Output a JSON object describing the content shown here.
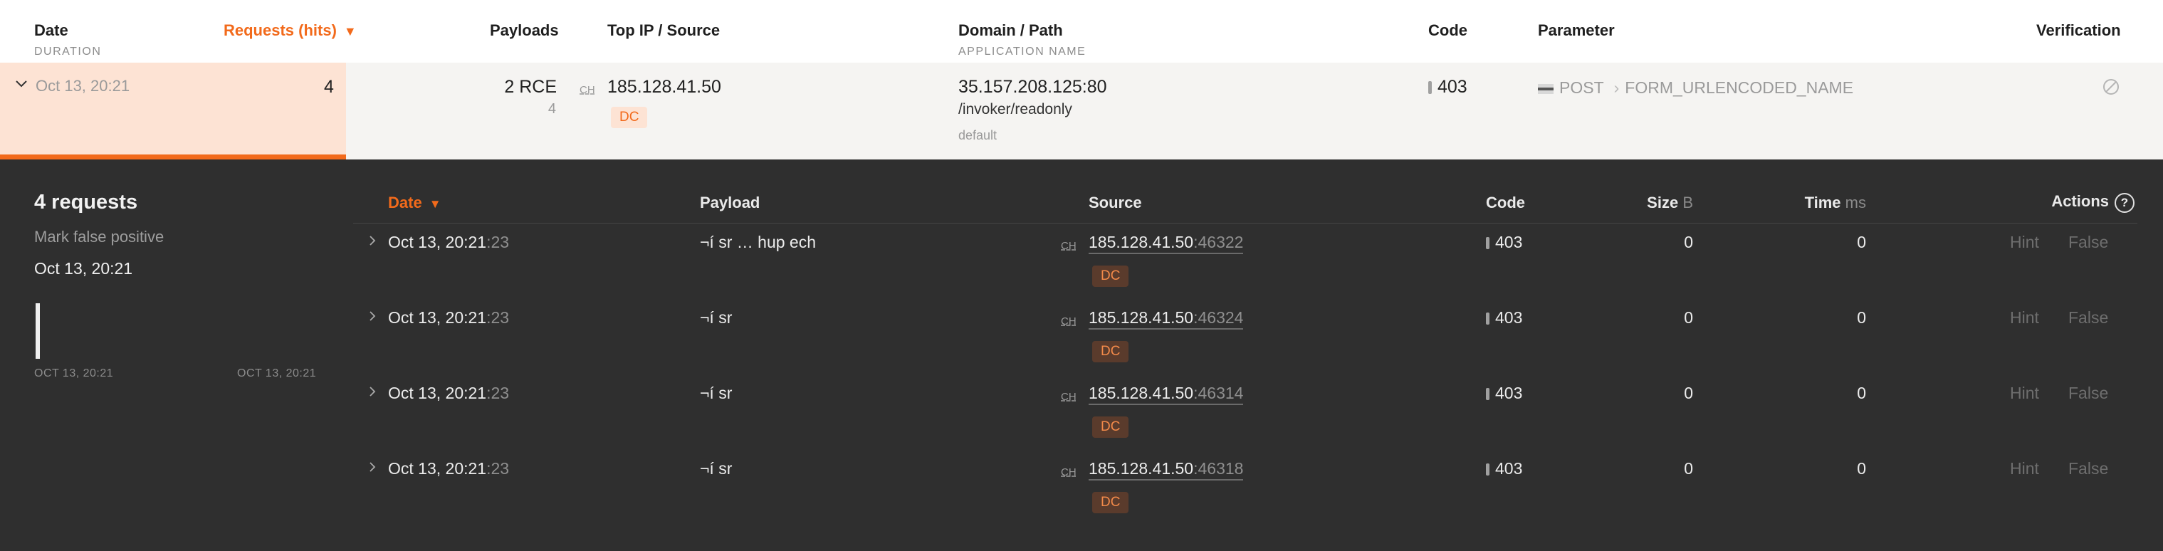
{
  "header": {
    "date": "Date",
    "duration": "DURATION",
    "requests": "Requests (hits)",
    "requests_caret": "▼",
    "payloads": "Payloads",
    "top_ip": "Top IP / Source",
    "domain": "Domain / Path",
    "app_name": "APPLICATION NAME",
    "code": "Code",
    "parameter": "Parameter",
    "verification": "Verification"
  },
  "summary": {
    "date": "Oct 13, 20:21",
    "hits": "4",
    "payloads": "2 RCE",
    "payloads_count": "4",
    "ch": "CH",
    "ip": "185.128.41.50",
    "dc": "DC",
    "domain": "35.157.208.125:80",
    "path": "/invoker/readonly",
    "app": "default",
    "code": "403",
    "method": "POST",
    "param_sep": "›",
    "param": "FORM_URLENCODED_NAME"
  },
  "detail": {
    "title": "4 requests",
    "mark_fp": "Mark false positive",
    "date": "Oct 13, 20:21",
    "timeline_start": "OCT 13, 20:21",
    "timeline_end": "OCT 13, 20:21",
    "columns": {
      "date": "Date",
      "date_caret": "▼",
      "payload": "Payload",
      "source": "Source",
      "code": "Code",
      "size": "Size",
      "size_unit": "B",
      "time": "Time",
      "time_unit": "ms",
      "actions": "Actions",
      "help": "?"
    },
    "rows": [
      {
        "date": "Oct 13, 20:21",
        "sec": ":23",
        "payload": "¬í sr … hup ech",
        "ch": "CH",
        "ip": "185.128.41.50",
        "port": ":46322",
        "dc": "DC",
        "code": "403",
        "size": "0",
        "time": "0",
        "hint": "Hint",
        "false": "False"
      },
      {
        "date": "Oct 13, 20:21",
        "sec": ":23",
        "payload": "¬í sr",
        "ch": "CH",
        "ip": "185.128.41.50",
        "port": ":46324",
        "dc": "DC",
        "code": "403",
        "size": "0",
        "time": "0",
        "hint": "Hint",
        "false": "False"
      },
      {
        "date": "Oct 13, 20:21",
        "sec": ":23",
        "payload": "¬í sr",
        "ch": "CH",
        "ip": "185.128.41.50",
        "port": ":46314",
        "dc": "DC",
        "code": "403",
        "size": "0",
        "time": "0",
        "hint": "Hint",
        "false": "False"
      },
      {
        "date": "Oct 13, 20:21",
        "sec": ":23",
        "payload": "¬í sr",
        "ch": "CH",
        "ip": "185.128.41.50",
        "port": ":46318",
        "dc": "DC",
        "code": "403",
        "size": "0",
        "time": "0",
        "hint": "Hint",
        "false": "False"
      }
    ]
  },
  "colors": {
    "accent": "#f26a1b",
    "panel_bg": "#2f2f2f",
    "selected_row_bg": "#fde3d4"
  }
}
